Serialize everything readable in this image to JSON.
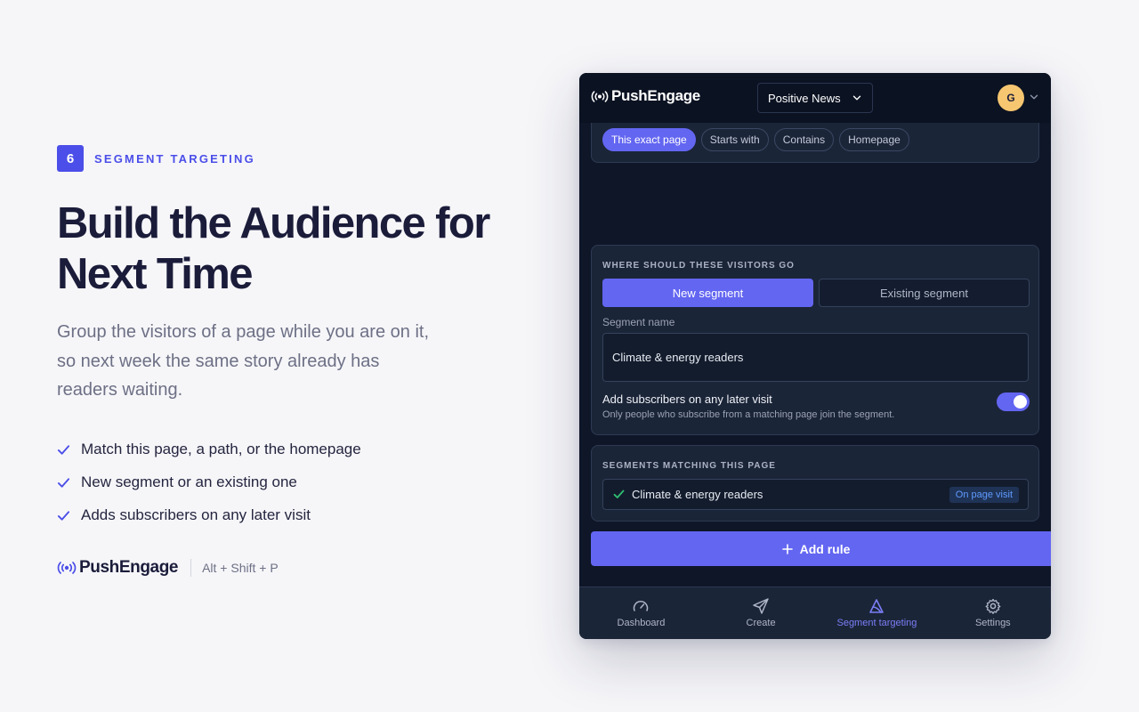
{
  "step": {
    "number": "6",
    "label": "SEGMENT TARGETING"
  },
  "headline": {
    "line1": "Build the Audience for",
    "line2": "Next Time"
  },
  "description": "Group the visitors of a page while you are on it, so next week the same story already has readers waiting.",
  "bullets": [
    "Match this page, a path, or the homepage",
    "New segment or an existing one",
    "Adds subscribers on any later visit"
  ],
  "brand": {
    "name": "PushEngage",
    "shortcut": "Alt + Shift + P"
  },
  "app": {
    "logo_text": "PushEngage",
    "site_selector": "Positive News",
    "avatar_initial": "G",
    "match_chips": [
      {
        "label": "This exact page",
        "active": true
      },
      {
        "label": "Starts with",
        "active": false
      },
      {
        "label": "Contains",
        "active": false
      },
      {
        "label": "Homepage",
        "active": false
      }
    ],
    "destination": {
      "title": "WHERE SHOULD THESE VISITORS GO",
      "new_segment": "New segment",
      "existing_segment": "Existing segment",
      "segment_name_label": "Segment name",
      "segment_name_value": "Climate & energy readers",
      "option_title": "Add subscribers on any later visit",
      "option_subtitle": "Only people who subscribe from a matching page join the segment.",
      "option_enabled": true
    },
    "matching": {
      "title": "SEGMENTS MATCHING THIS PAGE",
      "items": [
        {
          "name": "Climate & energy readers",
          "badge": "On page visit"
        }
      ]
    },
    "add_rule_label": "Add rule",
    "nav": [
      {
        "label": "Dashboard",
        "icon": "gauge-icon",
        "active": false
      },
      {
        "label": "Create",
        "icon": "send-icon",
        "active": false
      },
      {
        "label": "Segment targeting",
        "icon": "segment-icon",
        "active": true
      },
      {
        "label": "Settings",
        "icon": "gear-icon",
        "active": false
      }
    ],
    "colors": {
      "accent": "#6366f1",
      "background": "#0e1628",
      "card": "#1b2538"
    }
  }
}
